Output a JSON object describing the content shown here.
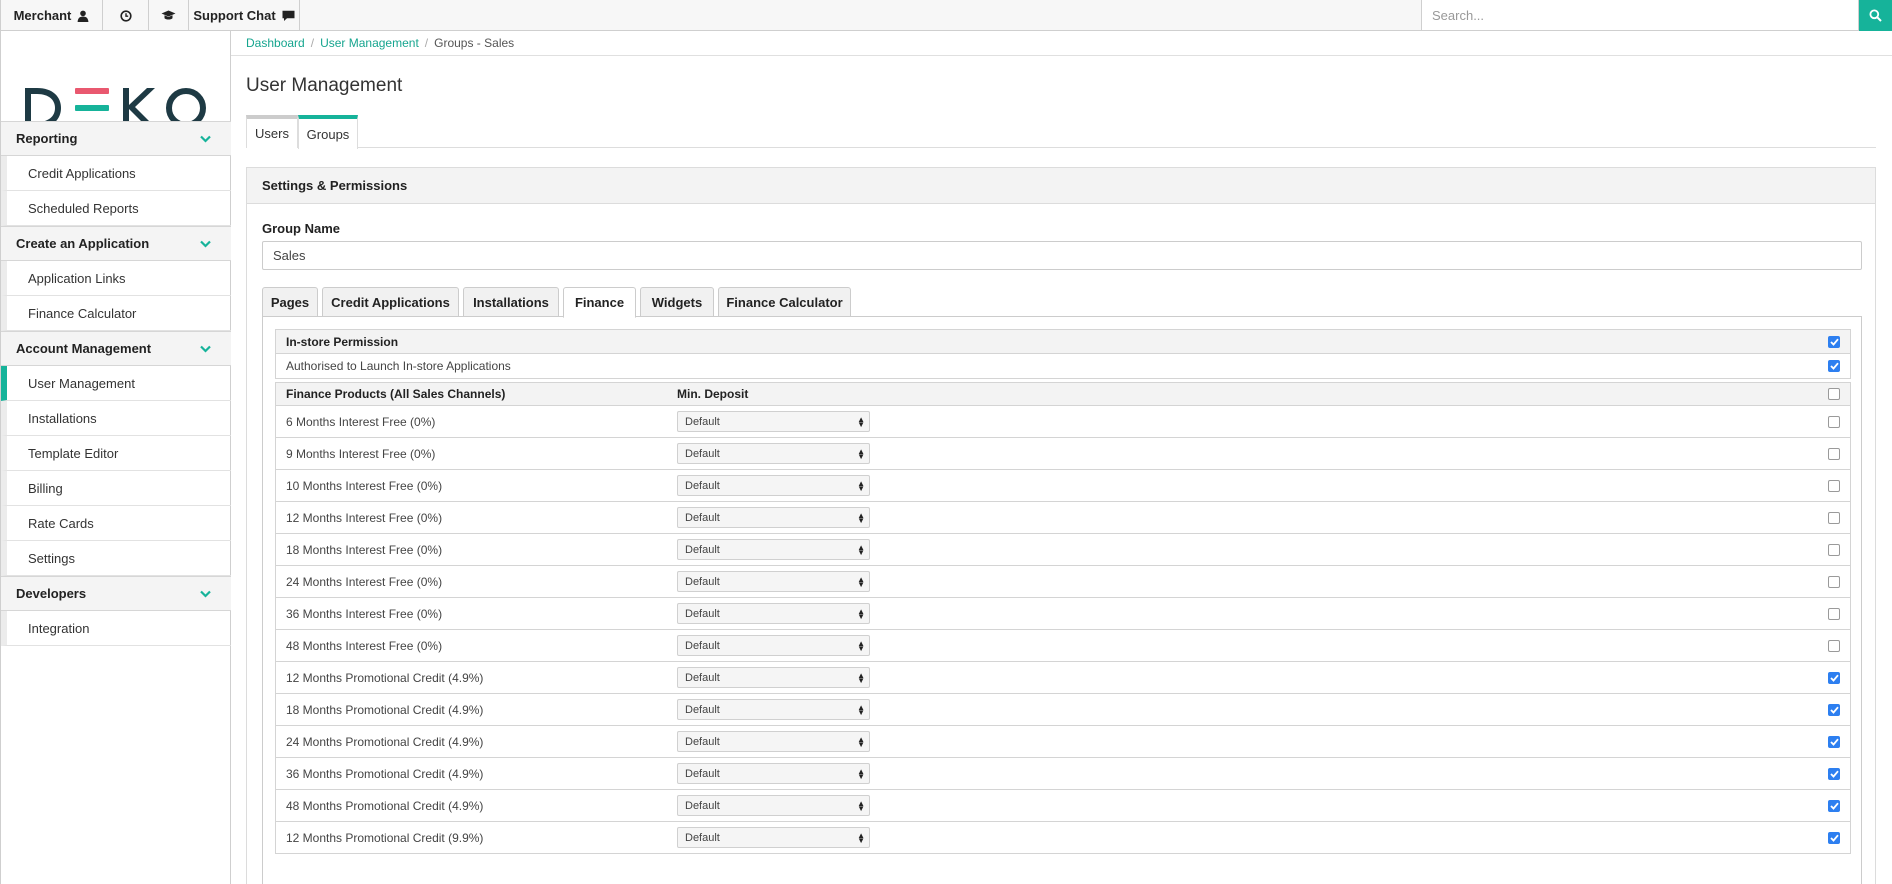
{
  "topbar": {
    "merchant_label": "Merchant",
    "support_label": "Support Chat",
    "search_placeholder": "Search..."
  },
  "logo": {
    "text": "DEKO",
    "colors": [
      "#e9586f",
      "#16b39a",
      "#f2a93b"
    ]
  },
  "sidebar": {
    "sections": [
      {
        "label": "Reporting",
        "items": [
          {
            "label": "Credit Applications",
            "active": false
          },
          {
            "label": "Scheduled Reports",
            "active": false
          }
        ]
      },
      {
        "label": "Create an Application",
        "items": [
          {
            "label": "Application Links",
            "active": false
          },
          {
            "label": "Finance Calculator",
            "active": false
          }
        ]
      },
      {
        "label": "Account Management",
        "items": [
          {
            "label": "User Management",
            "active": true
          },
          {
            "label": "Installations",
            "active": false
          },
          {
            "label": "Template Editor",
            "active": false
          },
          {
            "label": "Billing",
            "active": false
          },
          {
            "label": "Rate Cards",
            "active": false
          },
          {
            "label": "Settings",
            "active": false
          }
        ]
      },
      {
        "label": "Developers",
        "items": [
          {
            "label": "Integration",
            "active": false
          }
        ]
      }
    ]
  },
  "breadcrumb": {
    "items": [
      {
        "label": "Dashboard",
        "link": true
      },
      {
        "label": "User Management",
        "link": true
      },
      {
        "label": "Groups - Sales",
        "link": false
      }
    ]
  },
  "page": {
    "title": "User Management",
    "tabs": [
      {
        "label": "Users",
        "active": false
      },
      {
        "label": "Groups",
        "active": true
      }
    ]
  },
  "panel": {
    "heading": "Settings & Permissions",
    "group_name_label": "Group Name",
    "group_name_value": "Sales",
    "tabs": [
      {
        "label": "Pages",
        "active": false
      },
      {
        "label": "Credit Applications",
        "active": false
      },
      {
        "label": "Installations",
        "active": false
      },
      {
        "label": "Finance",
        "active": true
      },
      {
        "label": "Widgets",
        "active": false
      },
      {
        "label": "Finance Calculator",
        "active": false
      }
    ]
  },
  "instore": {
    "header": "In-store Permission",
    "header_checked": true,
    "rows": [
      {
        "label": "Authorised to Launch In-store Applications",
        "checked": true
      }
    ]
  },
  "finance": {
    "header_products": "Finance Products (All Sales Channels)",
    "header_deposit": "Min. Deposit",
    "header_checked": false,
    "rows": [
      {
        "name": "6 Months Interest Free (0%)",
        "deposit": "Default",
        "checked": false
      },
      {
        "name": "9 Months Interest Free (0%)",
        "deposit": "Default",
        "checked": false
      },
      {
        "name": "10 Months Interest Free (0%)",
        "deposit": "Default",
        "checked": false
      },
      {
        "name": "12 Months Interest Free (0%)",
        "deposit": "Default",
        "checked": false
      },
      {
        "name": "18 Months Interest Free (0%)",
        "deposit": "Default",
        "checked": false
      },
      {
        "name": "24 Months Interest Free (0%)",
        "deposit": "Default",
        "checked": false
      },
      {
        "name": "36 Months Interest Free (0%)",
        "deposit": "Default",
        "checked": false
      },
      {
        "name": "48 Months Interest Free (0%)",
        "deposit": "Default",
        "checked": false
      },
      {
        "name": "12 Months Promotional Credit (4.9%)",
        "deposit": "Default",
        "checked": true
      },
      {
        "name": "18 Months Promotional Credit (4.9%)",
        "deposit": "Default",
        "checked": true
      },
      {
        "name": "24 Months Promotional Credit (4.9%)",
        "deposit": "Default",
        "checked": true
      },
      {
        "name": "36 Months Promotional Credit (4.9%)",
        "deposit": "Default",
        "checked": true
      },
      {
        "name": "48 Months Promotional Credit (4.9%)",
        "deposit": "Default",
        "checked": true
      },
      {
        "name": "12 Months Promotional Credit (9.9%)",
        "deposit": "Default",
        "checked": true
      }
    ]
  }
}
